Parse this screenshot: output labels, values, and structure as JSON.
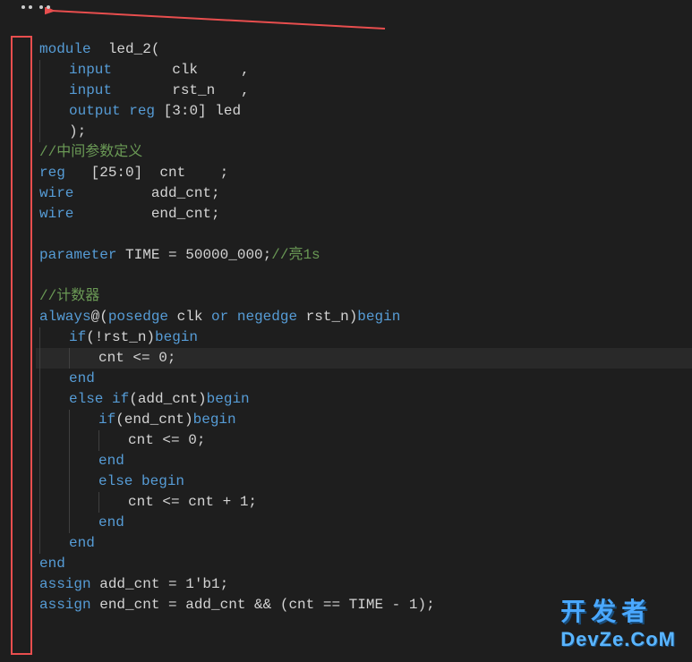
{
  "code": {
    "lines": [
      {
        "indent": 0,
        "tokens": [
          {
            "t": "module",
            "c": "kw"
          },
          {
            "t": "  led_2(",
            "c": "ident"
          }
        ]
      },
      {
        "indent": 1,
        "tokens": [
          {
            "t": "input",
            "c": "kw"
          },
          {
            "t": "       clk     ,",
            "c": "ident"
          }
        ]
      },
      {
        "indent": 1,
        "tokens": [
          {
            "t": "input",
            "c": "kw"
          },
          {
            "t": "       rst_n   ,",
            "c": "ident"
          }
        ]
      },
      {
        "indent": 1,
        "tokens": [
          {
            "t": "output",
            "c": "kw"
          },
          {
            "t": " ",
            "c": "ident"
          },
          {
            "t": "reg",
            "c": "kw"
          },
          {
            "t": " [3:0] led",
            "c": "ident"
          }
        ]
      },
      {
        "indent": 1,
        "tokens": [
          {
            "t": ");",
            "c": "punc"
          }
        ]
      },
      {
        "indent": 0,
        "tokens": [
          {
            "t": "//中间参数定义",
            "c": "cmt"
          }
        ]
      },
      {
        "indent": 0,
        "tokens": [
          {
            "t": "reg",
            "c": "kw"
          },
          {
            "t": "   [25:0]  cnt    ;",
            "c": "ident"
          }
        ]
      },
      {
        "indent": 0,
        "tokens": [
          {
            "t": "wire",
            "c": "kw"
          },
          {
            "t": "         add_cnt;",
            "c": "ident"
          }
        ]
      },
      {
        "indent": 0,
        "tokens": [
          {
            "t": "wire",
            "c": "kw"
          },
          {
            "t": "         end_cnt;",
            "c": "ident"
          }
        ]
      },
      {
        "indent": 0,
        "tokens": []
      },
      {
        "indent": 0,
        "tokens": [
          {
            "t": "parameter",
            "c": "kw"
          },
          {
            "t": " TIME = 50000_000;",
            "c": "ident"
          },
          {
            "t": "//亮1s",
            "c": "cmt"
          }
        ]
      },
      {
        "indent": 0,
        "tokens": []
      },
      {
        "indent": 0,
        "tokens": [
          {
            "t": "//计数器",
            "c": "cmt"
          }
        ]
      },
      {
        "indent": 0,
        "tokens": [
          {
            "t": "always",
            "c": "kw"
          },
          {
            "t": "@(",
            "c": "punc"
          },
          {
            "t": "posedge",
            "c": "kw"
          },
          {
            "t": " clk ",
            "c": "ident"
          },
          {
            "t": "or",
            "c": "kw"
          },
          {
            "t": " ",
            "c": "ident"
          },
          {
            "t": "negedge",
            "c": "kw"
          },
          {
            "t": " rst_n)",
            "c": "ident"
          },
          {
            "t": "begin",
            "c": "kw"
          }
        ]
      },
      {
        "indent": 1,
        "tokens": [
          {
            "t": "if",
            "c": "kw"
          },
          {
            "t": "(!rst_n)",
            "c": "ident"
          },
          {
            "t": "begin",
            "c": "kw"
          }
        ]
      },
      {
        "indent": 2,
        "highlight": true,
        "tokens": [
          {
            "t": "cnt <= 0;",
            "c": "ident"
          }
        ]
      },
      {
        "indent": 1,
        "tokens": [
          {
            "t": "end",
            "c": "kw"
          }
        ]
      },
      {
        "indent": 1,
        "tokens": [
          {
            "t": "else",
            "c": "kw"
          },
          {
            "t": " ",
            "c": "ident"
          },
          {
            "t": "if",
            "c": "kw"
          },
          {
            "t": "(add_cnt)",
            "c": "ident"
          },
          {
            "t": "begin",
            "c": "kw"
          }
        ]
      },
      {
        "indent": 2,
        "tokens": [
          {
            "t": "if",
            "c": "kw"
          },
          {
            "t": "(end_cnt)",
            "c": "ident"
          },
          {
            "t": "begin",
            "c": "kw"
          }
        ]
      },
      {
        "indent": 3,
        "tokens": [
          {
            "t": "cnt <= 0;",
            "c": "ident"
          }
        ]
      },
      {
        "indent": 2,
        "tokens": [
          {
            "t": "end",
            "c": "kw"
          }
        ]
      },
      {
        "indent": 2,
        "tokens": [
          {
            "t": "else",
            "c": "kw"
          },
          {
            "t": " ",
            "c": "ident"
          },
          {
            "t": "begin",
            "c": "kw"
          }
        ]
      },
      {
        "indent": 3,
        "tokens": [
          {
            "t": "cnt <= cnt + 1;",
            "c": "ident"
          }
        ]
      },
      {
        "indent": 2,
        "tokens": [
          {
            "t": "end",
            "c": "kw"
          }
        ]
      },
      {
        "indent": 1,
        "tokens": [
          {
            "t": "end",
            "c": "kw"
          }
        ]
      },
      {
        "indent": 0,
        "tokens": [
          {
            "t": "end",
            "c": "kw"
          }
        ]
      },
      {
        "indent": 0,
        "tokens": [
          {
            "t": "assign",
            "c": "kw"
          },
          {
            "t": " add_cnt = 1'b1;",
            "c": "ident"
          }
        ]
      },
      {
        "indent": 0,
        "tokens": [
          {
            "t": "assign",
            "c": "kw"
          },
          {
            "t": " end_cnt = add_cnt && (cnt == TIME - 1);",
            "c": "ident"
          }
        ]
      }
    ]
  },
  "watermark": {
    "line1": "开发者",
    "line2": "DevZe.CoM"
  }
}
